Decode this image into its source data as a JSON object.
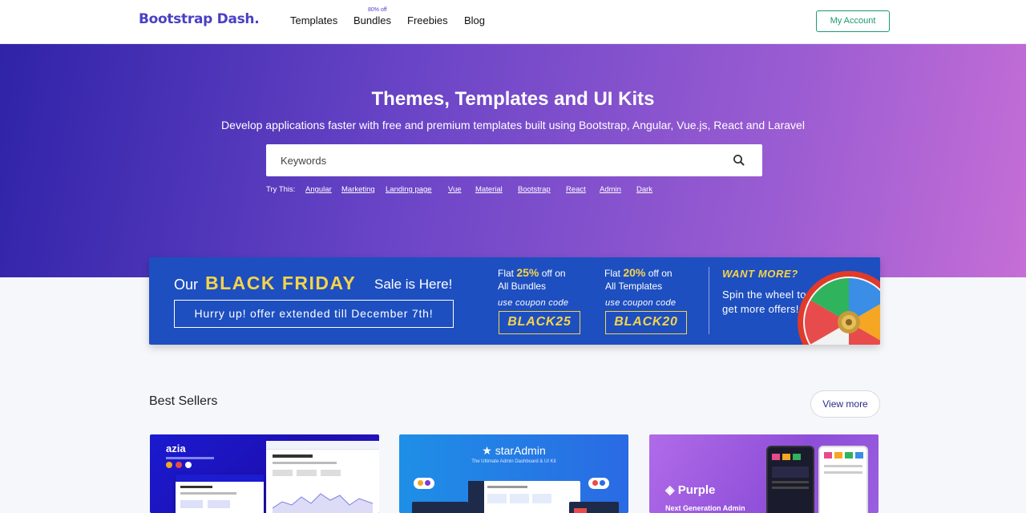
{
  "header": {
    "logo": "Bootstrap Dash.",
    "nav": {
      "templates": "Templates",
      "bundles": "Bundles",
      "bundles_badge": "80% off",
      "freebies": "Freebies",
      "blog": "Blog"
    },
    "account_button": "My Account"
  },
  "hero": {
    "title": "Themes, Templates and UI Kits",
    "subtitle": "Develop applications faster with free and premium templates built using Bootstrap, Angular, Vue.js, React and Laravel",
    "search_placeholder": "Keywords",
    "try_label": "Try This:",
    "try_links": [
      "Angular",
      "Marketing",
      "Landing page",
      "Vue",
      "Material",
      "Bootstrap",
      "React",
      "Admin",
      "Dark"
    ]
  },
  "promo": {
    "our": "Our",
    "black_friday": "BLACK FRIDAY",
    "sale": "Sale is Here!",
    "hurry": "Hurry up! offer extended till December 7th!",
    "offer1": {
      "prefix": "Flat",
      "pct": "25%",
      "suffix": "off on",
      "target": "All Bundles",
      "coupon_label": "use coupon code",
      "code": "BLACK25"
    },
    "offer2": {
      "prefix": "Flat",
      "pct": "20%",
      "suffix": "off on",
      "target": "All Templates",
      "coupon_label": "use coupon code",
      "code": "BLACK20"
    },
    "want_more": "WANT MORE?",
    "spin": "Spin the wheel to get more offers!",
    "accent": "#f6d44a",
    "background": "#1e4fc0"
  },
  "best_sellers": {
    "title": "Best Sellers",
    "view_more": "View more",
    "cards": [
      {
        "name": "azia"
      },
      {
        "name": "starAdmin",
        "tagline": "The Ultimate Admin Dashboard & UI Kit"
      },
      {
        "name": "Purple",
        "tagline": "Next Generation Admin"
      }
    ]
  }
}
